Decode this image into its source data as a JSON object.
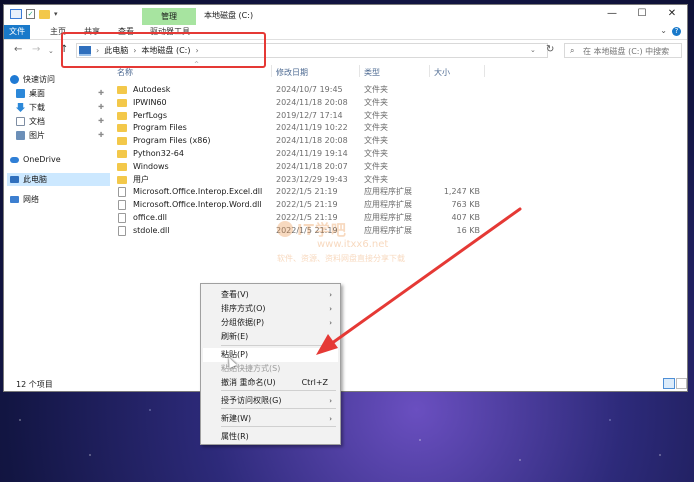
{
  "title_bar": {
    "context_tab_header": "管理",
    "window_title": "本地磁盘 (C:)",
    "buttons": {
      "minimize": "—",
      "maximize": "☐",
      "close": "✕"
    }
  },
  "ribbon": {
    "tabs": [
      "文件",
      "主页",
      "共享",
      "查看",
      "驱动器工具"
    ],
    "chevron": "⌄",
    "help": "?"
  },
  "nav": {
    "back": "←",
    "forward": "→",
    "recent": "⌄",
    "up": "↑",
    "breadcrumb": [
      "此电脑",
      "本地磁盘 (C:)"
    ],
    "separator": "›",
    "address_dropdown": "⌄",
    "refresh": "↻",
    "search_icon": "⌕",
    "search_placeholder": "在 本地磁盘 (C:) 中搜索"
  },
  "sidebar": {
    "quick_access": {
      "label": "快速访问",
      "icon": "star-icon",
      "color": "#1f7ad4"
    },
    "pinned": [
      {
        "label": "桌面",
        "icon": "desktop-icon",
        "color": "#2c88d9"
      },
      {
        "label": "下载",
        "icon": "download-icon",
        "color": "#2c88d9"
      },
      {
        "label": "文档",
        "icon": "document-icon",
        "color": "#7f8ea3"
      },
      {
        "label": "图片",
        "icon": "pictures-icon",
        "color": "#6c8fb8"
      }
    ],
    "pin_glyph": "📌",
    "onedrive": {
      "label": "OneDrive",
      "icon": "cloud-icon",
      "color": "#2f7fd6"
    },
    "this_pc": {
      "label": "此电脑",
      "icon": "computer-icon",
      "color": "#2f6fbd"
    },
    "network": {
      "label": "网络",
      "icon": "network-icon",
      "color": "#3d7fd0"
    }
  },
  "columns": {
    "name": "名称",
    "date": "修改日期",
    "type": "类型",
    "size": "大小",
    "sort_indicator": "^"
  },
  "files": [
    {
      "name": "Autodesk",
      "date": "2024/10/7 19:45",
      "type": "文件夹",
      "size": "",
      "kind": "folder"
    },
    {
      "name": "IPWIN60",
      "date": "2024/11/18 20:08",
      "type": "文件夹",
      "size": "",
      "kind": "folder"
    },
    {
      "name": "PerfLogs",
      "date": "2019/12/7 17:14",
      "type": "文件夹",
      "size": "",
      "kind": "folder"
    },
    {
      "name": "Program Files",
      "date": "2024/11/19 10:22",
      "type": "文件夹",
      "size": "",
      "kind": "folder"
    },
    {
      "name": "Program Files (x86)",
      "date": "2024/11/18 20:08",
      "type": "文件夹",
      "size": "",
      "kind": "folder"
    },
    {
      "name": "Python32-64",
      "date": "2024/11/19 19:14",
      "type": "文件夹",
      "size": "",
      "kind": "folder"
    },
    {
      "name": "Windows",
      "date": "2024/11/18 20:07",
      "type": "文件夹",
      "size": "",
      "kind": "folder"
    },
    {
      "name": "用户",
      "date": "2023/12/29 19:43",
      "type": "文件夹",
      "size": "",
      "kind": "folder"
    },
    {
      "name": "Microsoft.Office.Interop.Excel.dll",
      "date": "2022/1/5 21:19",
      "type": "应用程序扩展",
      "size": "1,247 KB",
      "kind": "dll"
    },
    {
      "name": "Microsoft.Office.Interop.Word.dll",
      "date": "2022/1/5 21:19",
      "type": "应用程序扩展",
      "size": "763 KB",
      "kind": "dll"
    },
    {
      "name": "office.dll",
      "date": "2022/1/5 21:19",
      "type": "应用程序扩展",
      "size": "407 KB",
      "kind": "dll"
    },
    {
      "name": "stdole.dll",
      "date": "2022/1/5 21:19",
      "type": "应用程序扩展",
      "size": "16 KB",
      "kind": "dll"
    }
  ],
  "watermark": {
    "brand": "IT学吧",
    "url": "www.itxx6.net",
    "tagline": "软件、资源、资料网盘直接分享下载"
  },
  "status": {
    "item_count": "12 个项目"
  },
  "context_menu": [
    {
      "label": "查看(V)",
      "shortcut": "",
      "submenu": true
    },
    {
      "label": "排序方式(O)",
      "shortcut": "",
      "submenu": true
    },
    {
      "label": "分组依据(P)",
      "shortcut": "",
      "submenu": true
    },
    {
      "label": "刷新(E)",
      "shortcut": "",
      "submenu": false
    },
    {
      "label": "粘贴(P)",
      "shortcut": "",
      "submenu": false
    },
    {
      "label": "粘贴快捷方式(S)",
      "shortcut": "",
      "submenu": false,
      "disabled": true
    },
    {
      "label": "撤消 重命名(U)",
      "shortcut": "Ctrl+Z",
      "submenu": false
    },
    {
      "label": "授予访问权限(G)",
      "shortcut": "",
      "submenu": true
    },
    {
      "label": "新建(W)",
      "shortcut": "",
      "submenu": true
    },
    {
      "label": "属性(R)",
      "shortcut": "",
      "submenu": false
    }
  ],
  "submenu_glyph": "›",
  "colors": {
    "ribbon_file": "#1979ca",
    "manage_tab": "#a7e4a0",
    "highlight_box": "#e53935",
    "arrow": "#e53935",
    "selection": "#cce8ff"
  }
}
